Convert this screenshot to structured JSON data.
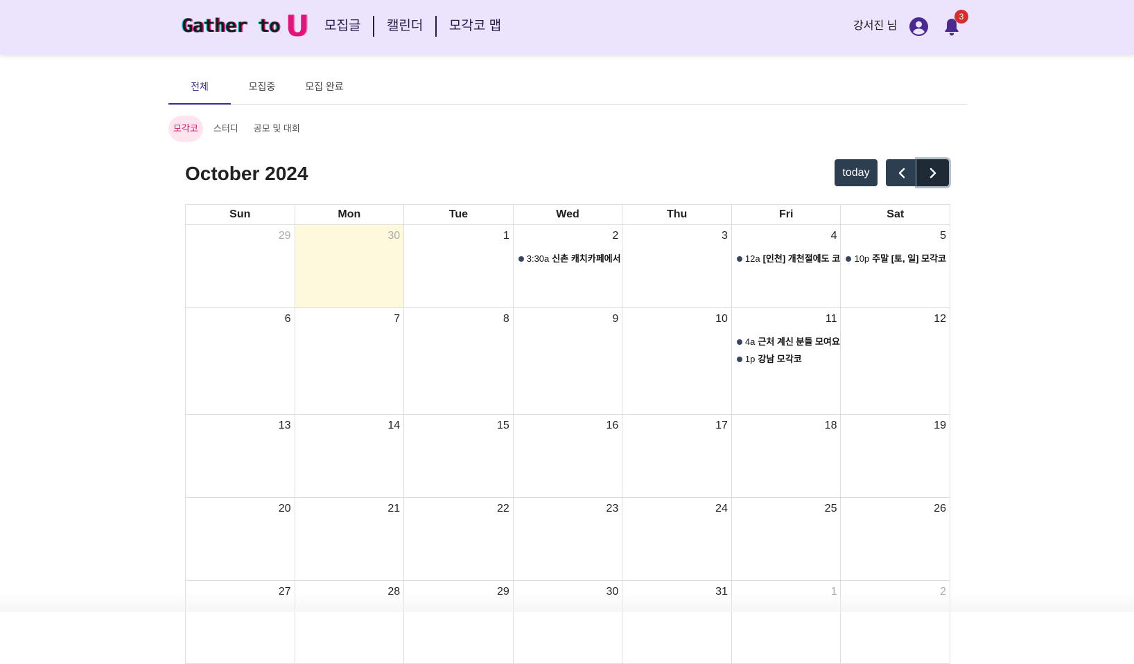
{
  "header": {
    "logo_text": "Gather to",
    "logo_u": "U",
    "nav": [
      "모집글",
      "캘린더",
      "모각코 맵"
    ],
    "user_name": "강서진 님",
    "notification_count": "3",
    "icons": {
      "avatar": "account-circle-icon",
      "bell": "bell-icon"
    }
  },
  "tabs": [
    {
      "label": "전체",
      "active": true
    },
    {
      "label": "모집중",
      "active": false
    },
    {
      "label": "모집 완료",
      "active": false
    }
  ],
  "chips": [
    {
      "label": "모각코",
      "active": true
    },
    {
      "label": "스터디",
      "active": false
    },
    {
      "label": "공모 및 대회",
      "active": false
    }
  ],
  "calendar": {
    "title": "October 2024",
    "today_label": "today",
    "weekdays": [
      "Sun",
      "Mon",
      "Tue",
      "Wed",
      "Thu",
      "Fri",
      "Sat"
    ],
    "weeks": [
      [
        {
          "day": "29",
          "other": true
        },
        {
          "day": "30",
          "other": true,
          "today": true
        },
        {
          "day": "1"
        },
        {
          "day": "2",
          "events": [
            {
              "time": "3:30a",
              "title": "신촌 캐치카페에서"
            }
          ]
        },
        {
          "day": "3"
        },
        {
          "day": "4",
          "events": [
            {
              "time": "12a",
              "title": "[인천] 개천절에도 코"
            }
          ]
        },
        {
          "day": "5",
          "events": [
            {
              "time": "10p",
              "title": "주말 [토, 일] 모각코"
            }
          ]
        }
      ],
      [
        {
          "day": "6"
        },
        {
          "day": "7"
        },
        {
          "day": "8"
        },
        {
          "day": "9"
        },
        {
          "day": "10"
        },
        {
          "day": "11",
          "events": [
            {
              "time": "4a",
              "title": "근처 계신 분들 모여요"
            },
            {
              "time": "1p",
              "title": "강남 모각코"
            }
          ]
        },
        {
          "day": "12"
        }
      ],
      [
        {
          "day": "13"
        },
        {
          "day": "14"
        },
        {
          "day": "15"
        },
        {
          "day": "16"
        },
        {
          "day": "17"
        },
        {
          "day": "18"
        },
        {
          "day": "19"
        }
      ],
      [
        {
          "day": "20"
        },
        {
          "day": "21"
        },
        {
          "day": "22"
        },
        {
          "day": "23"
        },
        {
          "day": "24"
        },
        {
          "day": "25"
        },
        {
          "day": "26"
        }
      ],
      [
        {
          "day": "27"
        },
        {
          "day": "28"
        },
        {
          "day": "29"
        },
        {
          "day": "30"
        },
        {
          "day": "31"
        },
        {
          "day": "1",
          "other": true
        },
        {
          "day": "2",
          "other": true
        }
      ]
    ]
  },
  "colors": {
    "header_bg": "#ece3fd",
    "accent": "#3b2a8a",
    "chip_active_bg": "#fde4ee",
    "chip_active_text": "#d0146a",
    "button_bg": "#2c3e50",
    "today_bg": "#fef9dc",
    "badge": "#d32f2f"
  }
}
